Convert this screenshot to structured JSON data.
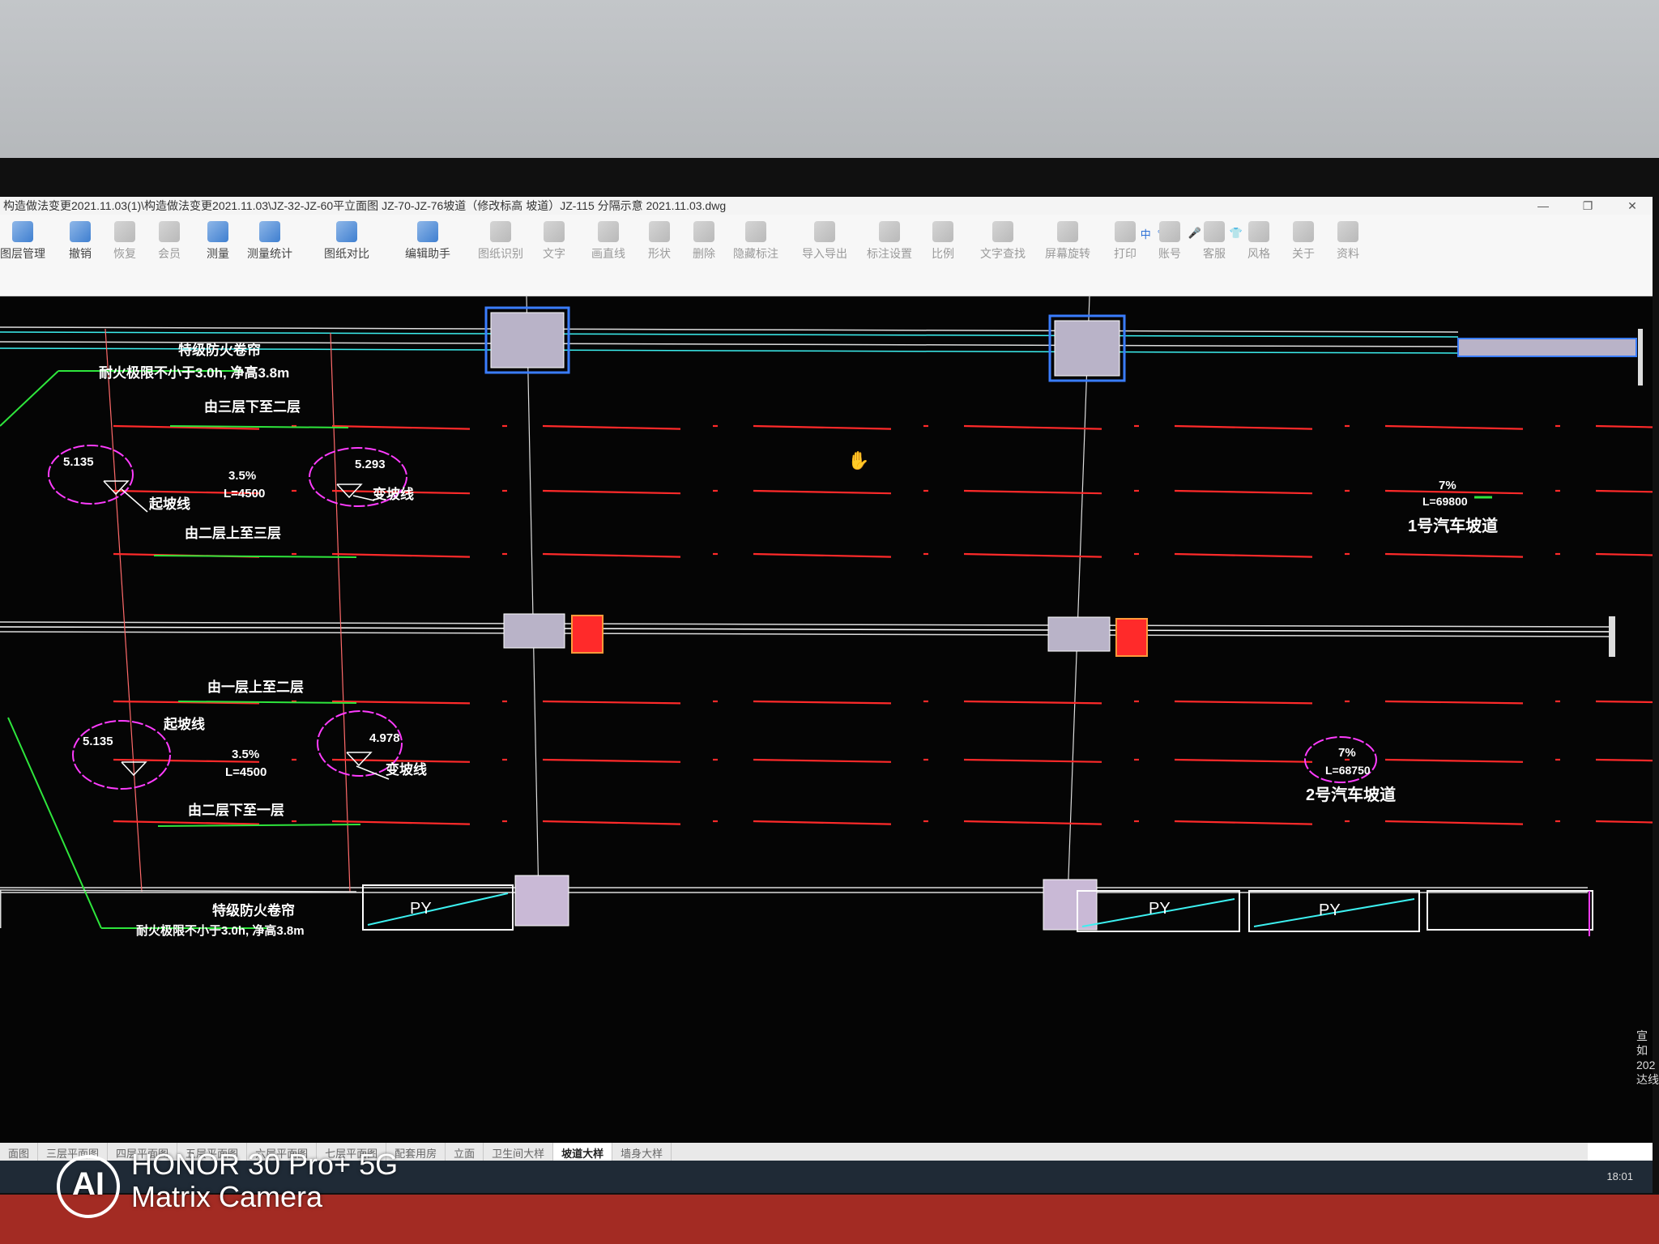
{
  "window": {
    "title": "构造做法变更2021.11.03(1)\\构造做法变更2021.11.03\\JZ-32-JZ-60平立面图 JZ-70-JZ-76坡道（修改标高 坡道）JZ-115 分隔示意 2021.11.03.dwg",
    "min": "—",
    "max": "❐",
    "close": "✕"
  },
  "tray": {
    "sogou": "S",
    "lang": "中",
    "punct": "°,",
    "emoji": "☺",
    "mic": "🎤",
    "kbd": "⌨",
    "shirt": "👕",
    "grid": "▦"
  },
  "toolbar": [
    {
      "label": "图层管理",
      "icon": "layers-icon"
    },
    {
      "label": "撤销",
      "icon": "undo-icon"
    },
    {
      "label": "恢复",
      "icon": "redo-icon"
    },
    {
      "label": "会员",
      "icon": "vip-icon"
    },
    {
      "label": "测量",
      "icon": "measure-icon"
    },
    {
      "label": "测量统计",
      "icon": "measure-stats-icon"
    },
    {
      "label": "图纸对比",
      "icon": "compare-icon"
    },
    {
      "label": "编辑助手",
      "icon": "edit-assistant-icon"
    },
    {
      "label": "图纸识别",
      "icon": "recognize-icon"
    },
    {
      "label": "文字",
      "icon": "text-icon"
    },
    {
      "label": "画直线",
      "icon": "line-icon"
    },
    {
      "label": "形状",
      "icon": "shape-icon"
    },
    {
      "label": "删除",
      "icon": "eraser-icon"
    },
    {
      "label": "隐藏标注",
      "icon": "eye-icon"
    },
    {
      "label": "导入导出",
      "icon": "import-export-icon"
    },
    {
      "label": "标注设置",
      "icon": "annotation-settings-icon"
    },
    {
      "label": "比例",
      "icon": "scale-icon"
    },
    {
      "label": "文字查找",
      "icon": "text-search-icon"
    },
    {
      "label": "屏幕旋转",
      "icon": "rotate-screen-icon"
    },
    {
      "label": "打印",
      "icon": "print-icon"
    },
    {
      "label": "账号",
      "icon": "account-icon"
    },
    {
      "label": "客服",
      "icon": "headset-icon"
    },
    {
      "label": "风格",
      "icon": "style-icon"
    },
    {
      "label": "关于",
      "icon": "info-icon"
    },
    {
      "label": "资料",
      "icon": "docs-icon"
    }
  ],
  "drawing": {
    "fire_shutter_top": "特级防火卷帘",
    "fire_note_top": "耐火极限不小于3.0h, 净高3.8m",
    "down_3_to_2": "由三层下至二层",
    "elev_a": "5.135",
    "elev_b": "5.293",
    "slope_a": "3.5%",
    "len_a": "L=4500",
    "start_line_a": "起坡线",
    "change_line_a": "变坡线",
    "up_2_to_3": "由二层上至三层",
    "slope_r1": "7%",
    "len_r1": "L=69800",
    "ramp_1": "1号汽车坡道",
    "up_1_to_2": "由一层上至二层",
    "start_line_b": "起坡线",
    "elev_c": "5.135",
    "slope_b": "3.5%",
    "len_b": "L=4500",
    "elev_d": "4.978",
    "change_line_b": "变坡线",
    "down_2_to_1": "由二层下至一层",
    "slope_r2": "7%",
    "len_r2": "L=68750",
    "ramp_2": "2号汽车坡道",
    "fire_shutter_bottom": "特级防火卷帘",
    "fire_note_bottom": "耐火极限不小于3.0h, 净高3.8m",
    "py1": "PY",
    "py2": "PY",
    "py3": "PY"
  },
  "tabs": [
    "面图",
    "三层平面图",
    "四层平面图",
    "五层平面图",
    "六层平面图",
    "七层平面图",
    "配套用房",
    "立面",
    "卫生间大样",
    "坡道大样",
    "墙身大样"
  ],
  "active_tab": "坡道大样",
  "clock": "18:01",
  "right_edge": [
    "宣",
    "如",
    "",
    "202",
    "达线"
  ],
  "watermark": {
    "logo": "AI",
    "line1": "HONOR 30 Pro+ 5G",
    "line2": "Matrix Camera"
  },
  "colors": {
    "background": "#050505",
    "red_line": "#ff2a2a",
    "magenta": "#ff3cff",
    "cyan": "#3cf0f0",
    "blue": "#3a7dff",
    "green": "#2ee63c"
  }
}
